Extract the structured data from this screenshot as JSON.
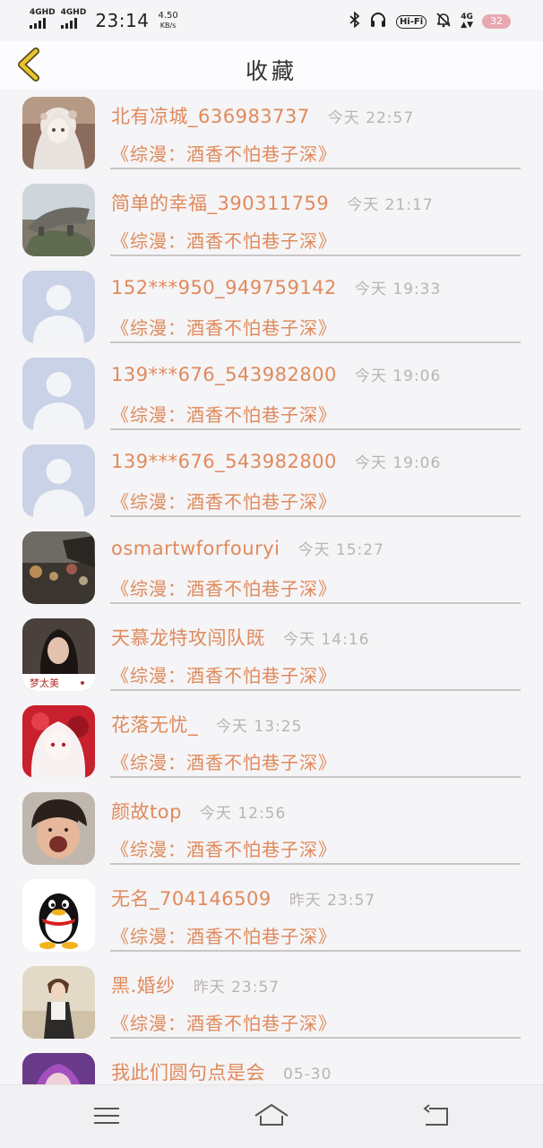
{
  "status_bar": {
    "network1": "4GHD",
    "network2": "4GHD",
    "time": "23:14",
    "speed": "4.50",
    "speed_unit": "KB/s",
    "hifi": "Hi-Fi",
    "network3": "4G",
    "battery": "32"
  },
  "header": {
    "title": "收藏"
  },
  "items": [
    {
      "name": "北有凉城_636983737",
      "time": "今天 22:57",
      "message": "《综漫：酒香不怕巷子深》",
      "avatar": "anime-girl-white"
    },
    {
      "name": "简单的幸福_390311759",
      "time": "今天 21:17",
      "message": "《综漫：酒香不怕巷子深》",
      "avatar": "rock-landscape"
    },
    {
      "name": "152***950_949759142",
      "time": "今天 19:33",
      "message": "《综漫：酒香不怕巷子深》",
      "avatar": "default-person"
    },
    {
      "name": "139***676_543982800",
      "time": "今天 19:06",
      "message": "《综漫：酒香不怕巷子深》",
      "avatar": "default-person"
    },
    {
      "name": "139***676_543982800",
      "time": "今天 19:06",
      "message": "《综漫：酒香不怕巷子深》",
      "avatar": "default-person"
    },
    {
      "name": "osmartwforfouryi",
      "time": "今天 15:27",
      "message": "《综漫：酒香不怕巷子深》",
      "avatar": "bokeh-night"
    },
    {
      "name": "天慕龙特攻闯队既",
      "time": "今天 14:16",
      "message": "《综漫：酒香不怕巷子深》",
      "avatar": "woman-photo",
      "avatar_caption": "梦太美"
    },
    {
      "name": "花落无忧_",
      "time": "今天 13:25",
      "message": "《综漫：酒香不怕巷子深》",
      "avatar": "anime-girl-red"
    },
    {
      "name": "颜故top",
      "time": "今天 12:56",
      "message": "《综漫：酒香不怕巷子深》",
      "avatar": "boy-face"
    },
    {
      "name": "无名_704146509",
      "time": "昨天 23:57",
      "message": "《综漫：酒香不怕巷子深》",
      "avatar": "qq-penguin"
    },
    {
      "name": "黑.婚纱",
      "time": "昨天 23:57",
      "message": "《综漫：酒香不怕巷子深》",
      "avatar": "anime-man"
    },
    {
      "name": "我此们圆句点是会",
      "time": "05-30",
      "message": "",
      "avatar": "purple-hair"
    }
  ],
  "colors": {
    "accent": "#e08a5c",
    "time_text": "#b9b4b2",
    "back_arrow": "#e8c531",
    "background": "#f5f4f6"
  },
  "navbar": {
    "menu_icon": "menu-icon",
    "home_icon": "home-icon",
    "back_icon": "back-icon"
  }
}
